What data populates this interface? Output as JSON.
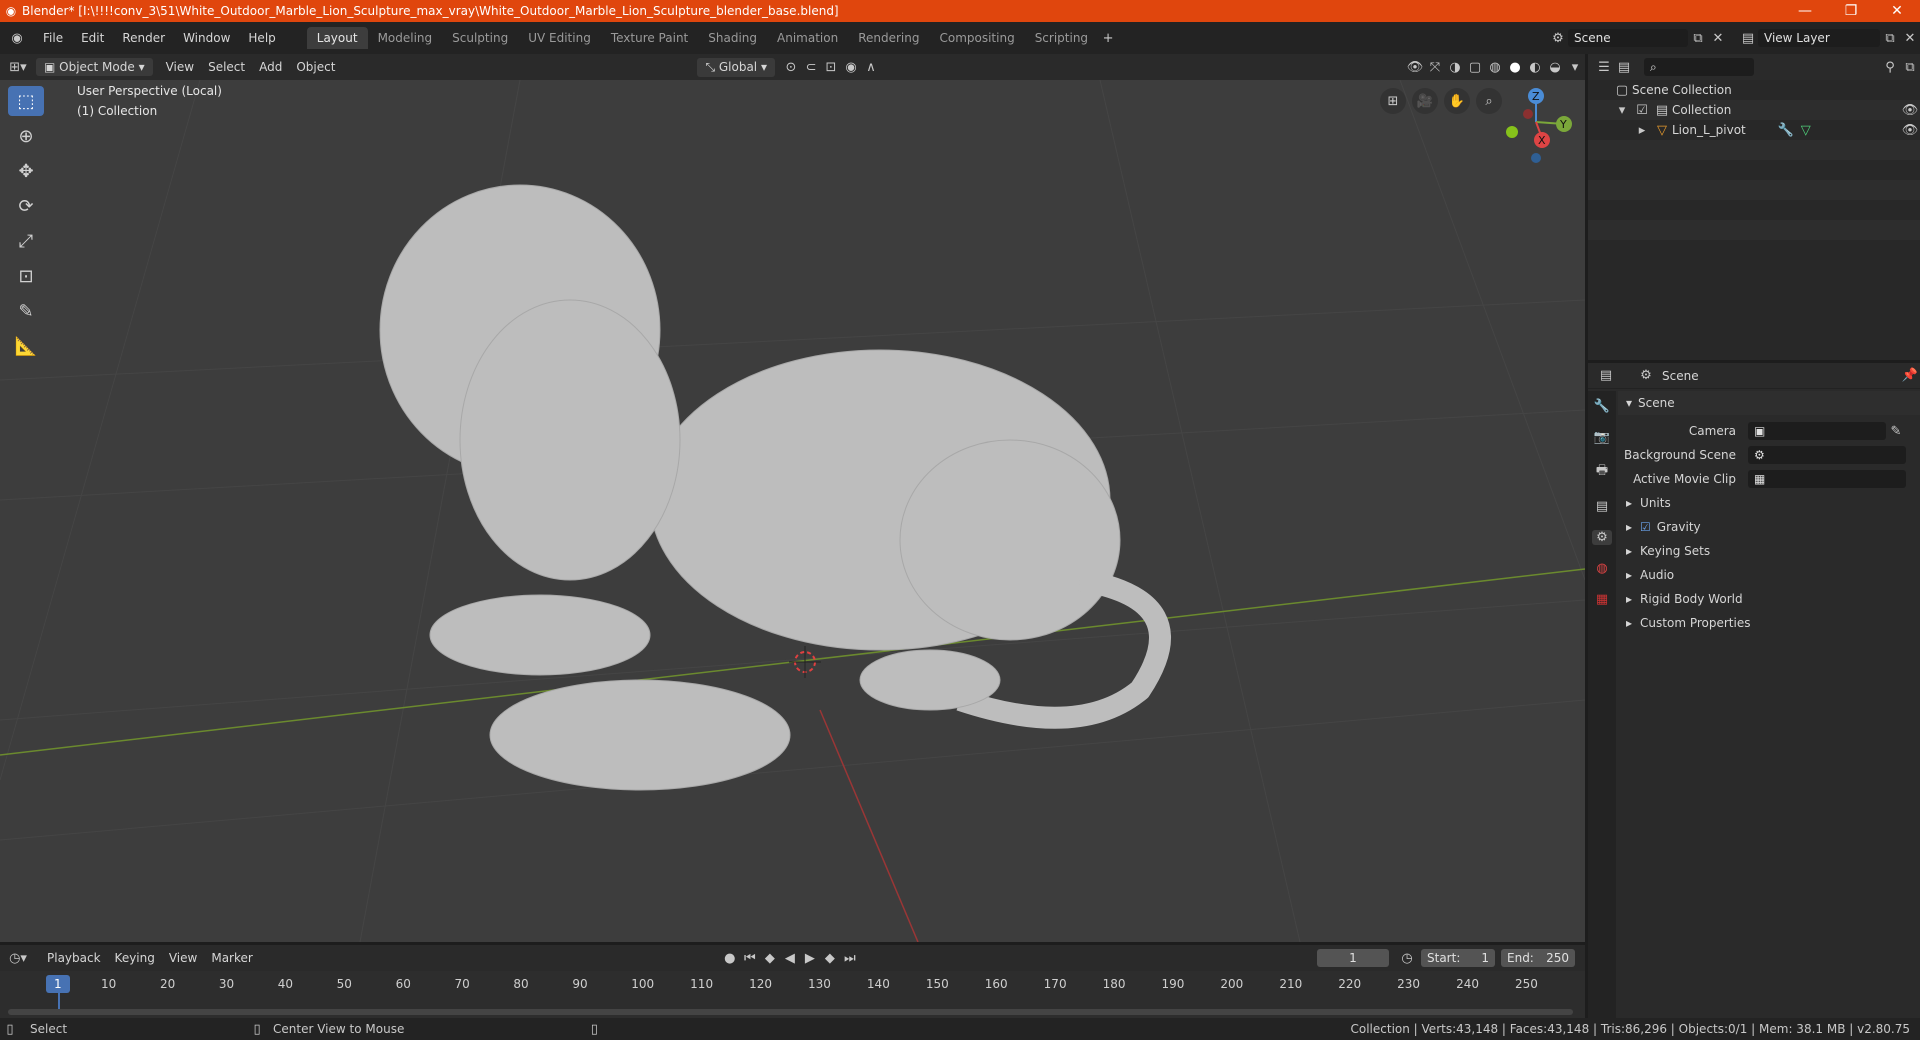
{
  "window": {
    "title": "Blender* [I:\\!!!!conv_3\\51\\White_Outdoor_Marble_Lion_Sculpture_max_vray\\White_Outdoor_Marble_Lion_Sculpture_blender_base.blend]"
  },
  "menu": [
    "File",
    "Edit",
    "Render",
    "Window",
    "Help"
  ],
  "workspaces": [
    "Layout",
    "Modeling",
    "Sculpting",
    "UV Editing",
    "Texture Paint",
    "Shading",
    "Animation",
    "Rendering",
    "Compositing",
    "Scripting"
  ],
  "scene": {
    "label": "Scene",
    "view_layer": "View Layer"
  },
  "viewport_header": {
    "mode": "Object Mode",
    "menus": [
      "View",
      "Select",
      "Add",
      "Object"
    ],
    "orientation": "Global"
  },
  "viewport": {
    "perspective": "User Perspective (Local)",
    "collection": "(1) Collection"
  },
  "gizmo": {
    "z": "Z",
    "y": "Y",
    "x": "X"
  },
  "outliner": {
    "root": "Scene Collection",
    "collection": "Collection",
    "object": "Lion_L_pivot"
  },
  "properties": {
    "header": "Scene",
    "panel": "Scene",
    "camera_label": "Camera",
    "bg_label": "Background Scene",
    "clip_label": "Active Movie Clip",
    "subpanels": [
      "Units",
      "Gravity",
      "Keying Sets",
      "Audio",
      "Rigid Body World",
      "Custom Properties"
    ]
  },
  "timeline": {
    "menus": [
      "Playback",
      "Keying",
      "View",
      "Marker"
    ],
    "current_frame": "1",
    "start_label": "Start:",
    "start": "1",
    "end_label": "End:",
    "end": "250",
    "ticks": [
      "1",
      "10",
      "20",
      "30",
      "40",
      "50",
      "60",
      "70",
      "80",
      "90",
      "100",
      "110",
      "120",
      "130",
      "140",
      "150",
      "160",
      "170",
      "180",
      "190",
      "200",
      "210",
      "220",
      "230",
      "240",
      "250"
    ]
  },
  "status": {
    "left": "Select",
    "middle": "Center View to Mouse",
    "right": "Collection | Verts:43,148 | Faces:43,148 | Tris:86,296 | Objects:0/1 | Mem: 38.1 MB | v2.80.75"
  }
}
